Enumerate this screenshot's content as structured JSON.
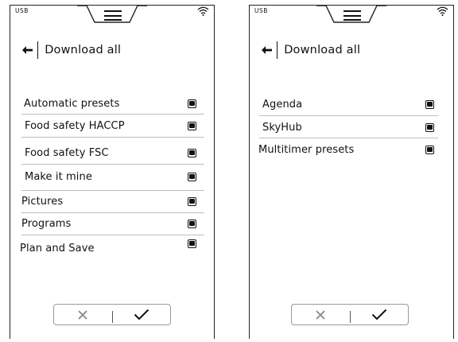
{
  "screens": [
    {
      "status": {
        "usb_label": "USB",
        "menu_icon": "hamburger-menu-icon",
        "wifi_icon": "wifi-icon"
      },
      "header": {
        "back_icon": "arrow-left-icon",
        "title": "Download all"
      },
      "items": [
        {
          "label": "Automatic presets",
          "checked": true
        },
        {
          "label": "Food safety HACCP",
          "checked": true
        },
        {
          "label": "Food safety FSC",
          "checked": true
        },
        {
          "label": "Make it mine",
          "checked": true
        },
        {
          "label": "Pictures",
          "checked": true
        },
        {
          "label": "Programs",
          "checked": true
        },
        {
          "label": "Plan and Save",
          "checked": true
        }
      ],
      "actions": {
        "cancel_icon": "close-icon",
        "confirm_icon": "checkmark-icon"
      }
    },
    {
      "status": {
        "usb_label": "USB",
        "menu_icon": "hamburger-menu-icon",
        "wifi_icon": "wifi-icon"
      },
      "header": {
        "back_icon": "arrow-left-icon",
        "title": "Download all"
      },
      "items": [
        {
          "label": "Agenda",
          "checked": true
        },
        {
          "label": "SkyHub",
          "checked": true
        },
        {
          "label": "Multitimer presets",
          "checked": true
        }
      ],
      "actions": {
        "cancel_icon": "close-icon",
        "confirm_icon": "checkmark-icon"
      }
    }
  ]
}
